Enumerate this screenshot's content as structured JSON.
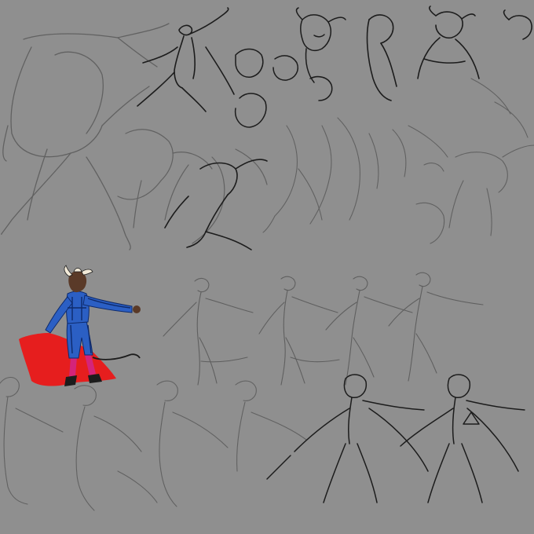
{
  "artwork": {
    "background_color": "#8f8f8f",
    "line_color": "#1c1c1c",
    "faint_line_color": "#5a5a5a",
    "cape_color": "#e61e1e",
    "suit_color": "#2b5fc4",
    "suit_trim_color": "#0e2a6b",
    "stocking_color": "#d4247a",
    "fur_color": "#5a3a28",
    "horn_color": "#f2ead8"
  }
}
